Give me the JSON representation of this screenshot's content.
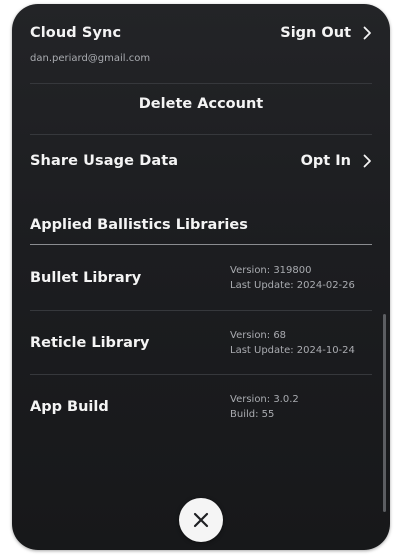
{
  "cloud_sync": {
    "label": "Cloud Sync",
    "action_label": "Sign Out",
    "email": "dan.periard@gmail.com"
  },
  "delete_account": {
    "label": "Delete Account"
  },
  "share_usage": {
    "label": "Share Usage Data",
    "action_label": "Opt In"
  },
  "libraries": {
    "title": "Applied Ballistics Libraries",
    "items": [
      {
        "name": "Bullet Library",
        "line1": "Version: 319800",
        "line2": "Last Update: 2024-02-26"
      },
      {
        "name": "Reticle Library",
        "line1": "Version: 68",
        "line2": "Last Update: 2024-10-24"
      },
      {
        "name": "App Build",
        "line1": "Version: 3.0.2",
        "line2": "Build: 55"
      }
    ]
  },
  "icons": {
    "chevron": "chevron-right-icon",
    "close": "close-icon"
  },
  "colors": {
    "panel_background": "#1c1d20",
    "text_primary": "#f4f4f4",
    "text_secondary": "#a9abb0",
    "close_button": "#f5f5f5"
  }
}
